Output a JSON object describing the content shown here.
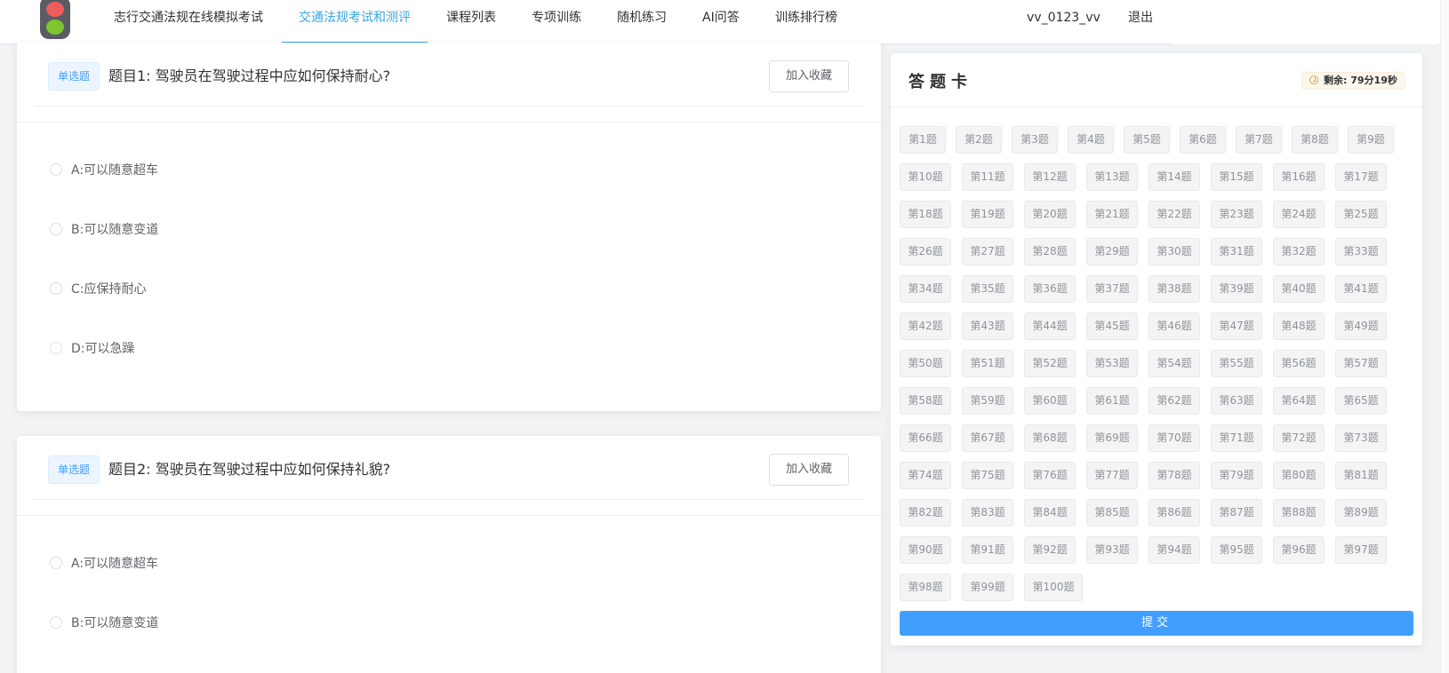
{
  "nav": {
    "items": [
      {
        "label": "志行交通法规在线模拟考试",
        "active": false
      },
      {
        "label": "交通法规考试和测评",
        "active": true
      },
      {
        "label": "课程列表",
        "active": false
      },
      {
        "label": "专项训练",
        "active": false
      },
      {
        "label": "随机练习",
        "active": false
      },
      {
        "label": "AI问答",
        "active": false
      },
      {
        "label": "训练排行榜",
        "active": false
      }
    ],
    "username": "vv_0123_vv",
    "logout": "退出"
  },
  "questions": [
    {
      "type": "单选题",
      "title": "题目1: 驾驶员在驾驶过程中应如何保持耐心?",
      "favorite": "加入收藏",
      "options": [
        "A:可以随意超车",
        "B:可以随意变道",
        "C:应保持耐心",
        "D:可以急躁"
      ]
    },
    {
      "type": "单选题",
      "title": "题目2: 驾驶员在驾驶过程中应如何保持礼貌?",
      "favorite": "加入收藏",
      "options": [
        "A:可以随意超车",
        "B:可以随意变道"
      ]
    }
  ],
  "sheet": {
    "title": "答题卡",
    "timer": "剩余: 79分19秒",
    "question_buttons": [
      "第1题",
      "第2题",
      "第3题",
      "第4题",
      "第5题",
      "第6题",
      "第7题",
      "第8题",
      "第9题",
      "第10题",
      "第11题",
      "第12题",
      "第13题",
      "第14题",
      "第15题",
      "第16题",
      "第17题",
      "第18题",
      "第19题",
      "第20题",
      "第21题",
      "第22题",
      "第23题",
      "第24题",
      "第25题",
      "第26题",
      "第27题",
      "第28题",
      "第29题",
      "第30题",
      "第31题",
      "第32题",
      "第33题",
      "第34题",
      "第35题",
      "第36题",
      "第37题",
      "第38题",
      "第39题",
      "第40题",
      "第41题",
      "第42题",
      "第43题",
      "第44题",
      "第45题",
      "第46题",
      "第47题",
      "第48题",
      "第49题",
      "第50题",
      "第51题",
      "第52题",
      "第53题",
      "第54题",
      "第55题",
      "第56题",
      "第57题",
      "第58题",
      "第59题",
      "第60题",
      "第61题",
      "第62题",
      "第63题",
      "第64题",
      "第65题",
      "第66题",
      "第67题",
      "第68题",
      "第69题",
      "第70题",
      "第71题",
      "第72题",
      "第73题",
      "第74题",
      "第75题",
      "第76题",
      "第77题",
      "第78题",
      "第79题",
      "第80题",
      "第81题",
      "第82题",
      "第83题",
      "第84题",
      "第85题",
      "第86题",
      "第87题",
      "第88题",
      "第89题",
      "第90题",
      "第91题",
      "第92题",
      "第93题",
      "第94题",
      "第95题",
      "第96题",
      "第97题",
      "第98题",
      "第99题",
      "第100题"
    ],
    "submit": "提交"
  },
  "colors": {
    "accent": "#409eff",
    "nav_active": "#3aa4e6",
    "logo_red": "#f05b5b",
    "logo_green": "#7fc52e"
  }
}
